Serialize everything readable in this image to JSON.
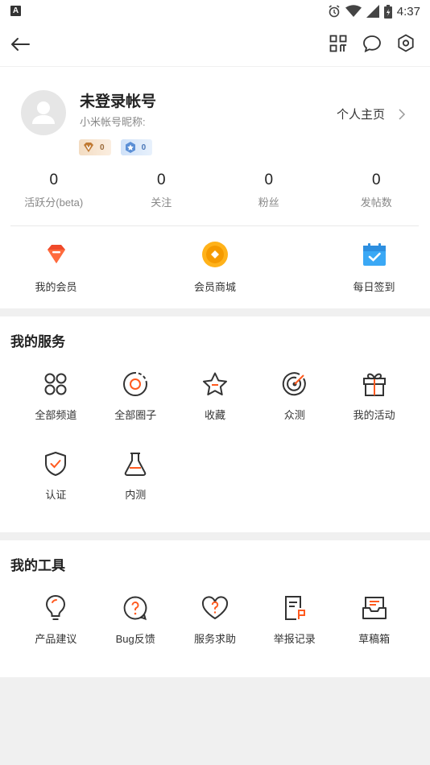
{
  "status_bar": {
    "badge": "A",
    "time": "4:37"
  },
  "profile": {
    "username": "未登录帐号",
    "nickname_label": "小米帐号昵称:",
    "level_badge": "0",
    "medal_badge": "0",
    "homepage_link": "个人主页"
  },
  "stats": [
    {
      "value": "0",
      "label": "活跃分(beta)"
    },
    {
      "value": "0",
      "label": "关注"
    },
    {
      "value": "0",
      "label": "粉丝"
    },
    {
      "value": "0",
      "label": "发帖数"
    }
  ],
  "quick_links": [
    {
      "label": "我的会员",
      "icon": "vip-gem-icon"
    },
    {
      "label": "会员商城",
      "icon": "coin-shop-icon"
    },
    {
      "label": "每日签到",
      "icon": "calendar-check-icon"
    }
  ],
  "services": {
    "title": "我的服务",
    "items": [
      {
        "label": "全部频道",
        "icon": "four-circles-icon"
      },
      {
        "label": "全部圈子",
        "icon": "circle-target-icon"
      },
      {
        "label": "收藏",
        "icon": "star-icon"
      },
      {
        "label": "众测",
        "icon": "radar-icon"
      },
      {
        "label": "我的活动",
        "icon": "gift-icon"
      },
      {
        "label": "认证",
        "icon": "shield-check-icon"
      },
      {
        "label": "内测",
        "icon": "flask-icon"
      }
    ]
  },
  "tools": {
    "title": "我的工具",
    "items": [
      {
        "label": "产品建议",
        "icon": "lightbulb-icon"
      },
      {
        "label": "Bug反馈",
        "icon": "question-bubble-icon"
      },
      {
        "label": "服务求助",
        "icon": "heart-question-icon"
      },
      {
        "label": "举报记录",
        "icon": "report-flag-icon"
      },
      {
        "label": "草稿箱",
        "icon": "inbox-icon"
      }
    ]
  },
  "colors": {
    "accent": "#ff5a1f",
    "text": "#222222",
    "muted": "#888888"
  }
}
